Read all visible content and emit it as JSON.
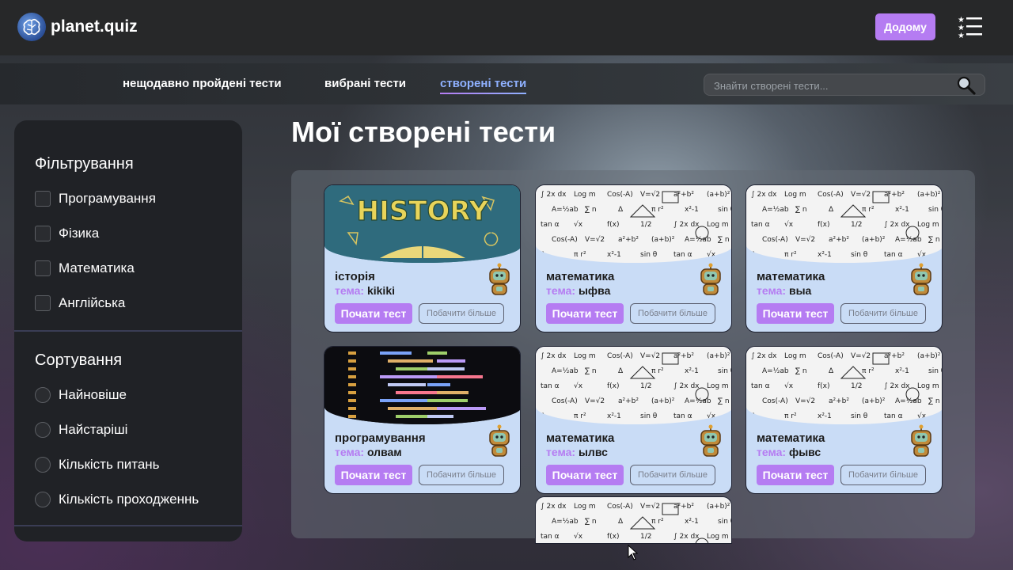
{
  "brand": {
    "name": "planet.quiz"
  },
  "header": {
    "home_label": "Додому"
  },
  "nav": {
    "tabs": [
      {
        "label": "нещодавно пройдені тести"
      },
      {
        "label": "вибрані тести"
      },
      {
        "label": "створені тести",
        "active": true
      }
    ],
    "search_placeholder": "Знайти створені тести..."
  },
  "sidebar": {
    "filter_title": "Фільтрування",
    "filters": [
      "Програмування",
      "Фізика",
      "Математика",
      "Англійська"
    ],
    "sort_title": "Сортування",
    "sorts": [
      "Найновіше",
      "Найстаріші",
      "Кількість питань",
      "Кількість проходженнь"
    ]
  },
  "main": {
    "title": "Мої створені тести",
    "topic_label": "тема:",
    "start_label": "Почати тест",
    "more_label": "Побачити більше",
    "cards": [
      {
        "subject": "історія",
        "topic": "kikiki",
        "image": "history",
        "image_text": "HISTORY"
      },
      {
        "subject": "математика",
        "topic": "ыфва",
        "image": "math"
      },
      {
        "subject": "математика",
        "topic": "выа",
        "image": "math"
      },
      {
        "subject": "програмування",
        "topic": "олвам",
        "image": "code"
      },
      {
        "subject": "математика",
        "topic": "ылвс",
        "image": "math"
      },
      {
        "subject": "математика",
        "topic": "фывс",
        "image": "math"
      },
      {
        "subject": "",
        "topic": "",
        "image": "math"
      }
    ]
  },
  "colors": {
    "accent": "#b57cf2",
    "card_bg": "#c9dcf6",
    "active_tab": "#8fb1ff"
  }
}
